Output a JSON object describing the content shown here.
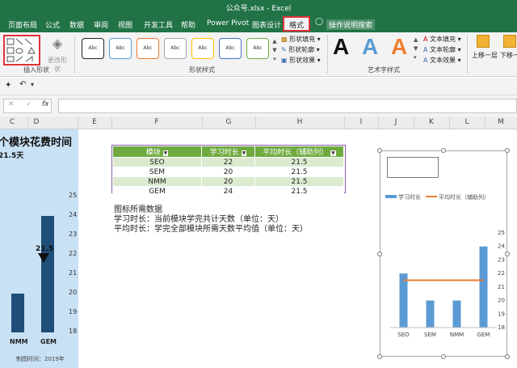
{
  "window": {
    "title": "公众号.xlsx  -  Excel"
  },
  "tabs": [
    {
      "label": "页面布局",
      "active": false
    },
    {
      "label": "公式",
      "active": false
    },
    {
      "label": "数据",
      "active": false
    },
    {
      "label": "审阅",
      "active": false
    },
    {
      "label": "视图",
      "active": false
    },
    {
      "label": "开发工具",
      "active": false
    },
    {
      "label": "帮助",
      "active": false
    },
    {
      "label": "Power Pivot",
      "active": false
    },
    {
      "label": "图表设计",
      "active": false
    },
    {
      "label": "格式",
      "active": true
    }
  ],
  "tell_me": "操作说明搜索",
  "ribbon": {
    "insert_shapes_label": "插入形状",
    "edit_shape_label": "更改形状",
    "shape_styles_label": "形状样式",
    "shape_style_sample": "Abc",
    "shape_fill": "形状填充",
    "shape_outline": "形状轮廓",
    "shape_effects": "形状效果",
    "wordart_label": "艺术字样式",
    "wordart_sample": "A",
    "text_fill": "文本填充",
    "text_outline": "文本轮廓",
    "text_effects": "文本效果",
    "bring_forward": "上移一层",
    "send_backward": "下移一"
  },
  "formula_bar": {
    "name_box": "",
    "fx": "fx",
    "formula": ""
  },
  "columns": [
    "C",
    "D",
    "E",
    "F",
    "G",
    "H",
    "I",
    "J",
    "K",
    "L",
    "M"
  ],
  "left_panel": {
    "title": "个模块花费时间",
    "subtitle": "21.5天",
    "marker_value": "21.5",
    "footer": "制图时间：2019年",
    "categories": [
      "NMM",
      "GEM"
    ],
    "values": [
      20,
      24
    ],
    "y_ticks": [
      "25",
      "24",
      "23",
      "22",
      "21",
      "20",
      "19",
      "18"
    ]
  },
  "table": {
    "headers": [
      "模块",
      "学习时长",
      "平均时长（辅助列）"
    ],
    "rows": [
      [
        "SEO",
        "22",
        "21.5"
      ],
      [
        "SEM",
        "20",
        "21.5"
      ],
      [
        "NMM",
        "20",
        "21.5"
      ],
      [
        "GEM",
        "24",
        "21.5"
      ]
    ]
  },
  "notes": [
    "图标所需数据",
    "学习时长：当前模块学完共计天数（单位：天）",
    "平均时长：学完全部模块所需天数平均值（单位：天）"
  ],
  "chart_data": {
    "type": "bar",
    "title": "",
    "categories": [
      "SEO",
      "SEM",
      "NMM",
      "GEM"
    ],
    "series": [
      {
        "name": "学习时长",
        "type": "bar",
        "values": [
          22,
          20,
          20,
          24
        ],
        "color": "#5b9bd5"
      },
      {
        "name": "平均时长（辅助列）",
        "type": "line",
        "values": [
          21.5,
          21.5,
          21.5,
          21.5
        ],
        "color": "#ed7d31"
      }
    ],
    "ylim": [
      18,
      25
    ],
    "y_ticks": [
      18,
      19,
      20,
      21,
      22,
      23,
      24,
      25
    ],
    "legend": "top",
    "grid": false
  },
  "colors": {
    "excel_green": "#217346",
    "table_header": "#6faa3f",
    "table_band": "#dcebd0",
    "left_bar": "#1f4e79",
    "left_bg": "#c9e1f5",
    "active_outline": "#e0333a"
  }
}
